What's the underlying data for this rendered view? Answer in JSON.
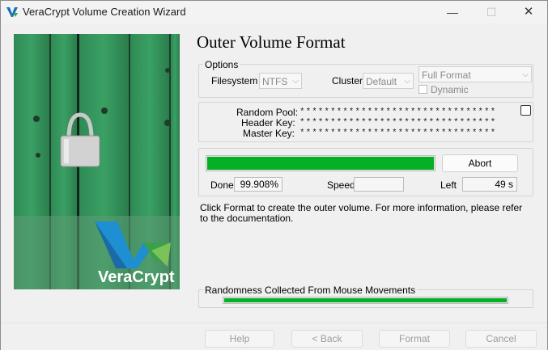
{
  "window": {
    "title": "VeraCrypt Volume Creation Wizard",
    "minimize_glyph": "—",
    "maximize_glyph": "☐",
    "close_glyph": "✕"
  },
  "branding": {
    "logo_text": "VeraCrypt",
    "accent_colors": [
      "#1e9bd7",
      "#2a7c3c",
      "#6bbf4e"
    ]
  },
  "page": {
    "heading": "Outer Volume Format"
  },
  "options": {
    "group_label": "Options",
    "filesystem_label": "Filesystem",
    "filesystem_value": "NTFS",
    "cluster_label": "Cluster",
    "cluster_value": "Default",
    "format_mode_value": "Full Format",
    "dynamic_label": "Dynamic"
  },
  "keys": {
    "random_pool_label": "Random Pool:",
    "random_pool_value": "********************************",
    "header_key_label": "Header Key:",
    "header_key_value": "********************************",
    "master_key_label": "Master Key:",
    "master_key_value": "********************************"
  },
  "progress": {
    "fraction": 0.99908,
    "abort_label": "Abort",
    "done_label": "Done",
    "done_value": "99.908%",
    "speed_label": "Speed",
    "speed_value": "",
    "left_label": "Left",
    "left_value": "49 s",
    "bar_color": "#06b025"
  },
  "info_text": "Click Format to create the outer volume. For more information, please refer to the documentation.",
  "randomness": {
    "label": "Randomness Collected From Mouse Movements",
    "fraction": 1.0
  },
  "footer": {
    "help_label": "Help",
    "back_label": "< Back",
    "format_label": "Format",
    "cancel_label": "Cancel"
  }
}
